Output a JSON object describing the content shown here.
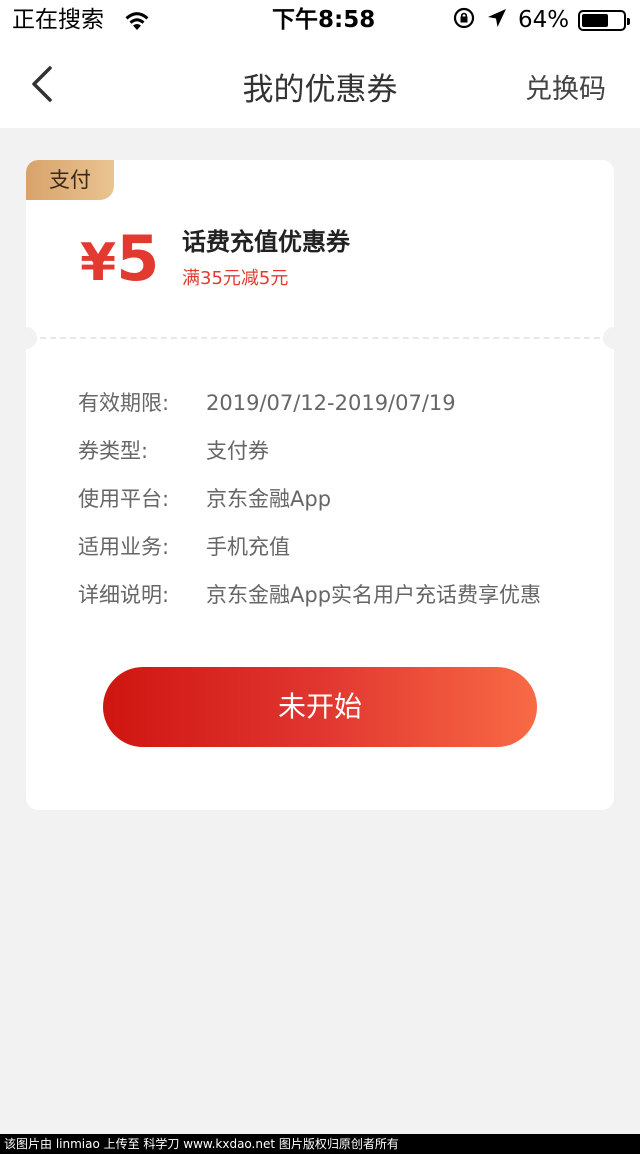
{
  "status_bar": {
    "carrier": "正在搜索",
    "time": "下午8:58",
    "battery_percent": "64%",
    "battery_level": 0.64,
    "icons": [
      "wifi-icon",
      "orientation-lock-icon",
      "location-icon",
      "battery-icon"
    ]
  },
  "nav": {
    "title": "我的优惠券",
    "right_action": "兑换码",
    "back_icon": "chevron-left-icon"
  },
  "coupon": {
    "tag": "支付",
    "currency_symbol": "¥",
    "amount": "5",
    "name": "话费充值优惠券",
    "condition": "满35元减5元",
    "details": [
      {
        "label": "有效期限:",
        "value": "2019/07/12-2019/07/19"
      },
      {
        "label": "券类型:",
        "value": "支付券"
      },
      {
        "label": "使用平台:",
        "value": "京东金融App"
      },
      {
        "label": "适用业务:",
        "value": "手机充值"
      },
      {
        "label": "详细说明:",
        "value": "京东金融App实名用户充话费享优惠"
      }
    ],
    "action_label": "未开始"
  },
  "footer": {
    "text": "该图片由 linmiao 上传至 科学刀 www.kxdao.net 图片版权归原创者所有"
  },
  "colors": {
    "accent_red": "#e23a31",
    "tag_gold": "#d8a36b",
    "background": "#f2f2f2"
  }
}
